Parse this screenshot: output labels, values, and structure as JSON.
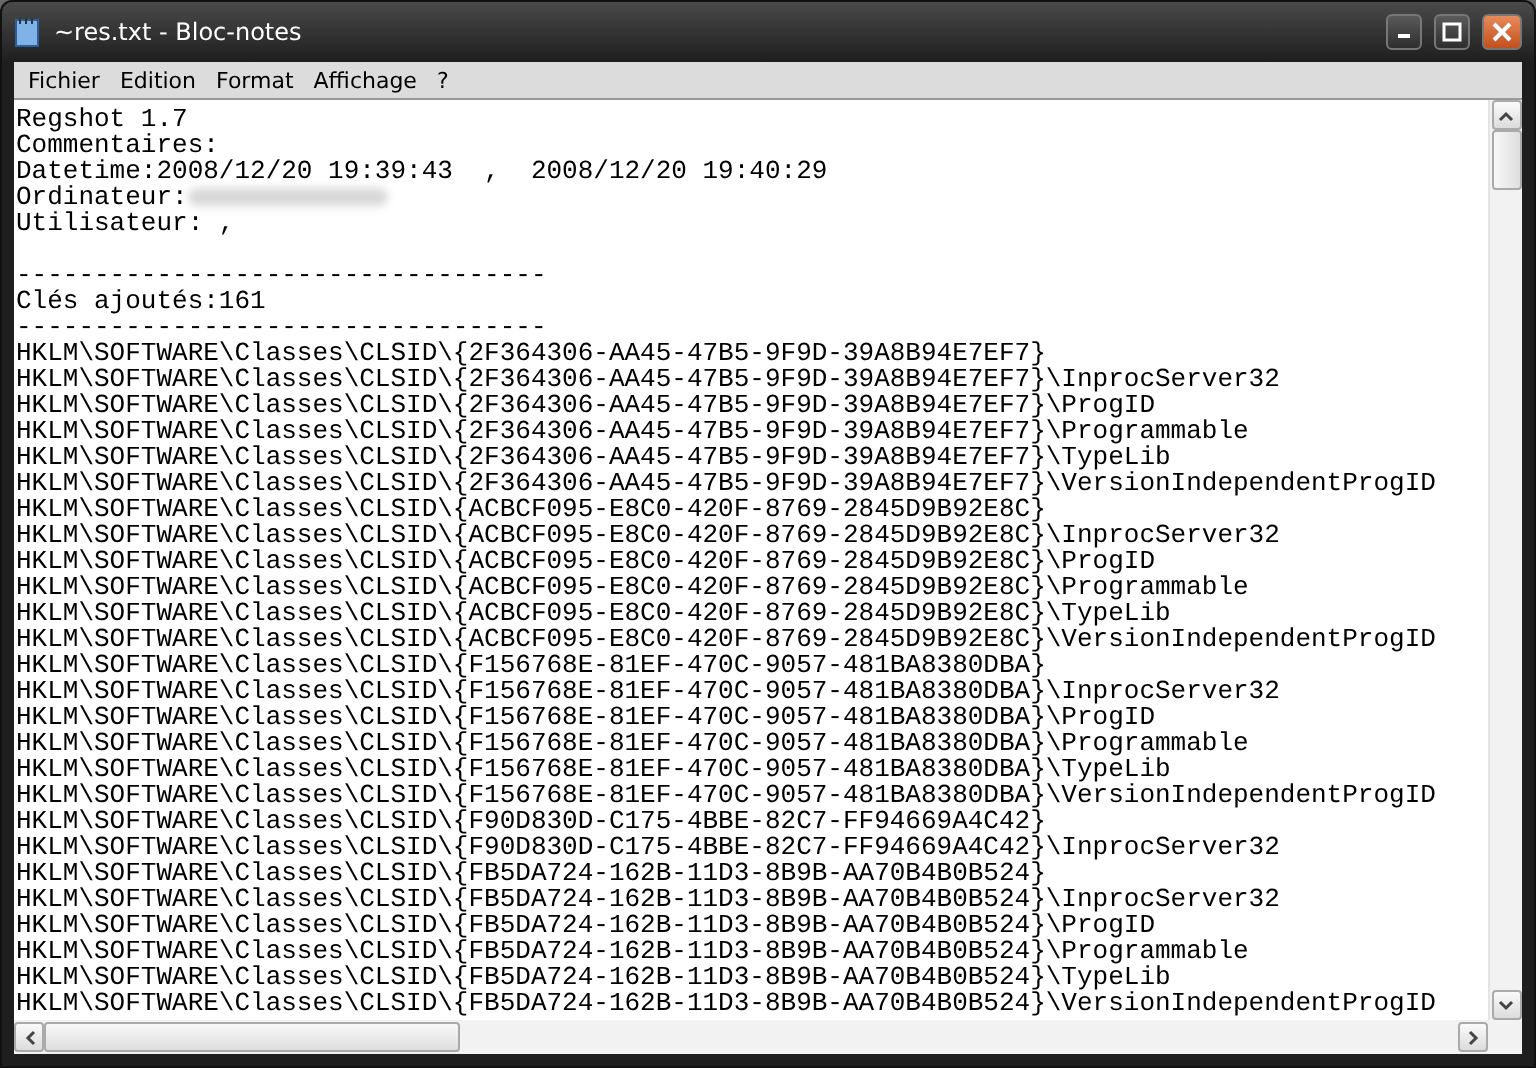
{
  "window": {
    "title": "~res.txt - Bloc-notes"
  },
  "menu": [
    {
      "label": "Fichier"
    },
    {
      "label": "Edition"
    },
    {
      "label": "Format"
    },
    {
      "label": "Affichage"
    },
    {
      "label": "?"
    }
  ],
  "document": {
    "lines": [
      {
        "kind": "text",
        "text": "Regshot 1.7"
      },
      {
        "kind": "text",
        "text": "Commentaires:"
      },
      {
        "kind": "text",
        "text": "Datetime:2008/12/20 19:39:43  ,  2008/12/20 19:40:29"
      },
      {
        "kind": "redacted",
        "text": "Ordinateur:"
      },
      {
        "kind": "text",
        "text": "Utilisateur: ,"
      },
      {
        "kind": "blank"
      },
      {
        "kind": "text",
        "text": "----------------------------------"
      },
      {
        "kind": "text",
        "text": "Clés ajoutés:161"
      },
      {
        "kind": "text",
        "text": "----------------------------------"
      },
      {
        "kind": "text",
        "text": "HKLM\\SOFTWARE\\Classes\\CLSID\\{2F364306-AA45-47B5-9F9D-39A8B94E7EF7}"
      },
      {
        "kind": "text",
        "text": "HKLM\\SOFTWARE\\Classes\\CLSID\\{2F364306-AA45-47B5-9F9D-39A8B94E7EF7}\\InprocServer32"
      },
      {
        "kind": "text",
        "text": "HKLM\\SOFTWARE\\Classes\\CLSID\\{2F364306-AA45-47B5-9F9D-39A8B94E7EF7}\\ProgID"
      },
      {
        "kind": "text",
        "text": "HKLM\\SOFTWARE\\Classes\\CLSID\\{2F364306-AA45-47B5-9F9D-39A8B94E7EF7}\\Programmable"
      },
      {
        "kind": "text",
        "text": "HKLM\\SOFTWARE\\Classes\\CLSID\\{2F364306-AA45-47B5-9F9D-39A8B94E7EF7}\\TypeLib"
      },
      {
        "kind": "text",
        "text": "HKLM\\SOFTWARE\\Classes\\CLSID\\{2F364306-AA45-47B5-9F9D-39A8B94E7EF7}\\VersionIndependentProgID"
      },
      {
        "kind": "text",
        "text": "HKLM\\SOFTWARE\\Classes\\CLSID\\{ACBCF095-E8C0-420F-8769-2845D9B92E8C}"
      },
      {
        "kind": "text",
        "text": "HKLM\\SOFTWARE\\Classes\\CLSID\\{ACBCF095-E8C0-420F-8769-2845D9B92E8C}\\InprocServer32"
      },
      {
        "kind": "text",
        "text": "HKLM\\SOFTWARE\\Classes\\CLSID\\{ACBCF095-E8C0-420F-8769-2845D9B92E8C}\\ProgID"
      },
      {
        "kind": "text",
        "text": "HKLM\\SOFTWARE\\Classes\\CLSID\\{ACBCF095-E8C0-420F-8769-2845D9B92E8C}\\Programmable"
      },
      {
        "kind": "text",
        "text": "HKLM\\SOFTWARE\\Classes\\CLSID\\{ACBCF095-E8C0-420F-8769-2845D9B92E8C}\\TypeLib"
      },
      {
        "kind": "text",
        "text": "HKLM\\SOFTWARE\\Classes\\CLSID\\{ACBCF095-E8C0-420F-8769-2845D9B92E8C}\\VersionIndependentProgID"
      },
      {
        "kind": "text",
        "text": "HKLM\\SOFTWARE\\Classes\\CLSID\\{F156768E-81EF-470C-9057-481BA8380DBA}"
      },
      {
        "kind": "text",
        "text": "HKLM\\SOFTWARE\\Classes\\CLSID\\{F156768E-81EF-470C-9057-481BA8380DBA}\\InprocServer32"
      },
      {
        "kind": "text",
        "text": "HKLM\\SOFTWARE\\Classes\\CLSID\\{F156768E-81EF-470C-9057-481BA8380DBA}\\ProgID"
      },
      {
        "kind": "text",
        "text": "HKLM\\SOFTWARE\\Classes\\CLSID\\{F156768E-81EF-470C-9057-481BA8380DBA}\\Programmable"
      },
      {
        "kind": "text",
        "text": "HKLM\\SOFTWARE\\Classes\\CLSID\\{F156768E-81EF-470C-9057-481BA8380DBA}\\TypeLib"
      },
      {
        "kind": "text",
        "text": "HKLM\\SOFTWARE\\Classes\\CLSID\\{F156768E-81EF-470C-9057-481BA8380DBA}\\VersionIndependentProgID"
      },
      {
        "kind": "text",
        "text": "HKLM\\SOFTWARE\\Classes\\CLSID\\{F90D830D-C175-4BBE-82C7-FF94669A4C42}"
      },
      {
        "kind": "text",
        "text": "HKLM\\SOFTWARE\\Classes\\CLSID\\{F90D830D-C175-4BBE-82C7-FF94669A4C42}\\InprocServer32"
      },
      {
        "kind": "text",
        "text": "HKLM\\SOFTWARE\\Classes\\CLSID\\{FB5DA724-162B-11D3-8B9B-AA70B4B0B524}"
      },
      {
        "kind": "text",
        "text": "HKLM\\SOFTWARE\\Classes\\CLSID\\{FB5DA724-162B-11D3-8B9B-AA70B4B0B524}\\InprocServer32"
      },
      {
        "kind": "text",
        "text": "HKLM\\SOFTWARE\\Classes\\CLSID\\{FB5DA724-162B-11D3-8B9B-AA70B4B0B524}\\ProgID"
      },
      {
        "kind": "text",
        "text": "HKLM\\SOFTWARE\\Classes\\CLSID\\{FB5DA724-162B-11D3-8B9B-AA70B4B0B524}\\Programmable"
      },
      {
        "kind": "text",
        "text": "HKLM\\SOFTWARE\\Classes\\CLSID\\{FB5DA724-162B-11D3-8B9B-AA70B4B0B524}\\TypeLib"
      },
      {
        "kind": "text",
        "text": "HKLM\\SOFTWARE\\Classes\\CLSID\\{FB5DA724-162B-11D3-8B9B-AA70B4B0B524}\\VersionIndependentProgID"
      }
    ]
  }
}
